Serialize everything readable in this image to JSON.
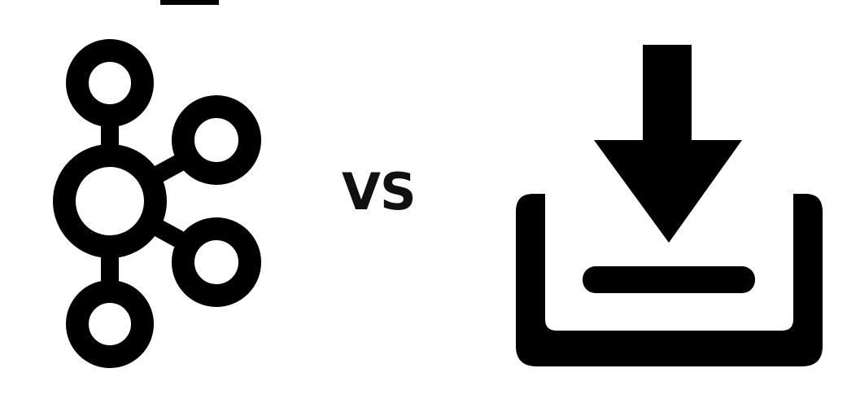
{
  "comparison": {
    "left_icon": "kafka-icon",
    "separator_label": "VS",
    "right_icon": "download-icon"
  },
  "colors": {
    "foreground": "#000000",
    "background": "#ffffff"
  }
}
